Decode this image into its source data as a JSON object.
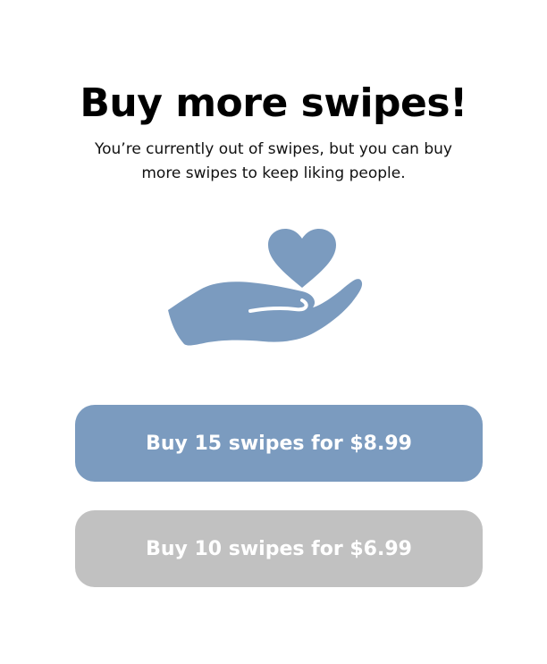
{
  "header": {
    "title": "Buy more swipes!",
    "subtitle": "You’re currently out of swipes, but you can buy more swipes to keep liking people."
  },
  "illustration": {
    "icon": "hand-holding-heart-icon",
    "color": "#7b9bbf"
  },
  "purchase_options": [
    {
      "label": "Buy 15 swipes for $8.99",
      "swipes": 15,
      "price": "$8.99",
      "color": "#7b9bbf"
    },
    {
      "label": "Buy 10 swipes for $6.99",
      "swipes": 10,
      "price": "$6.99",
      "color": "#c1c1c1"
    }
  ]
}
